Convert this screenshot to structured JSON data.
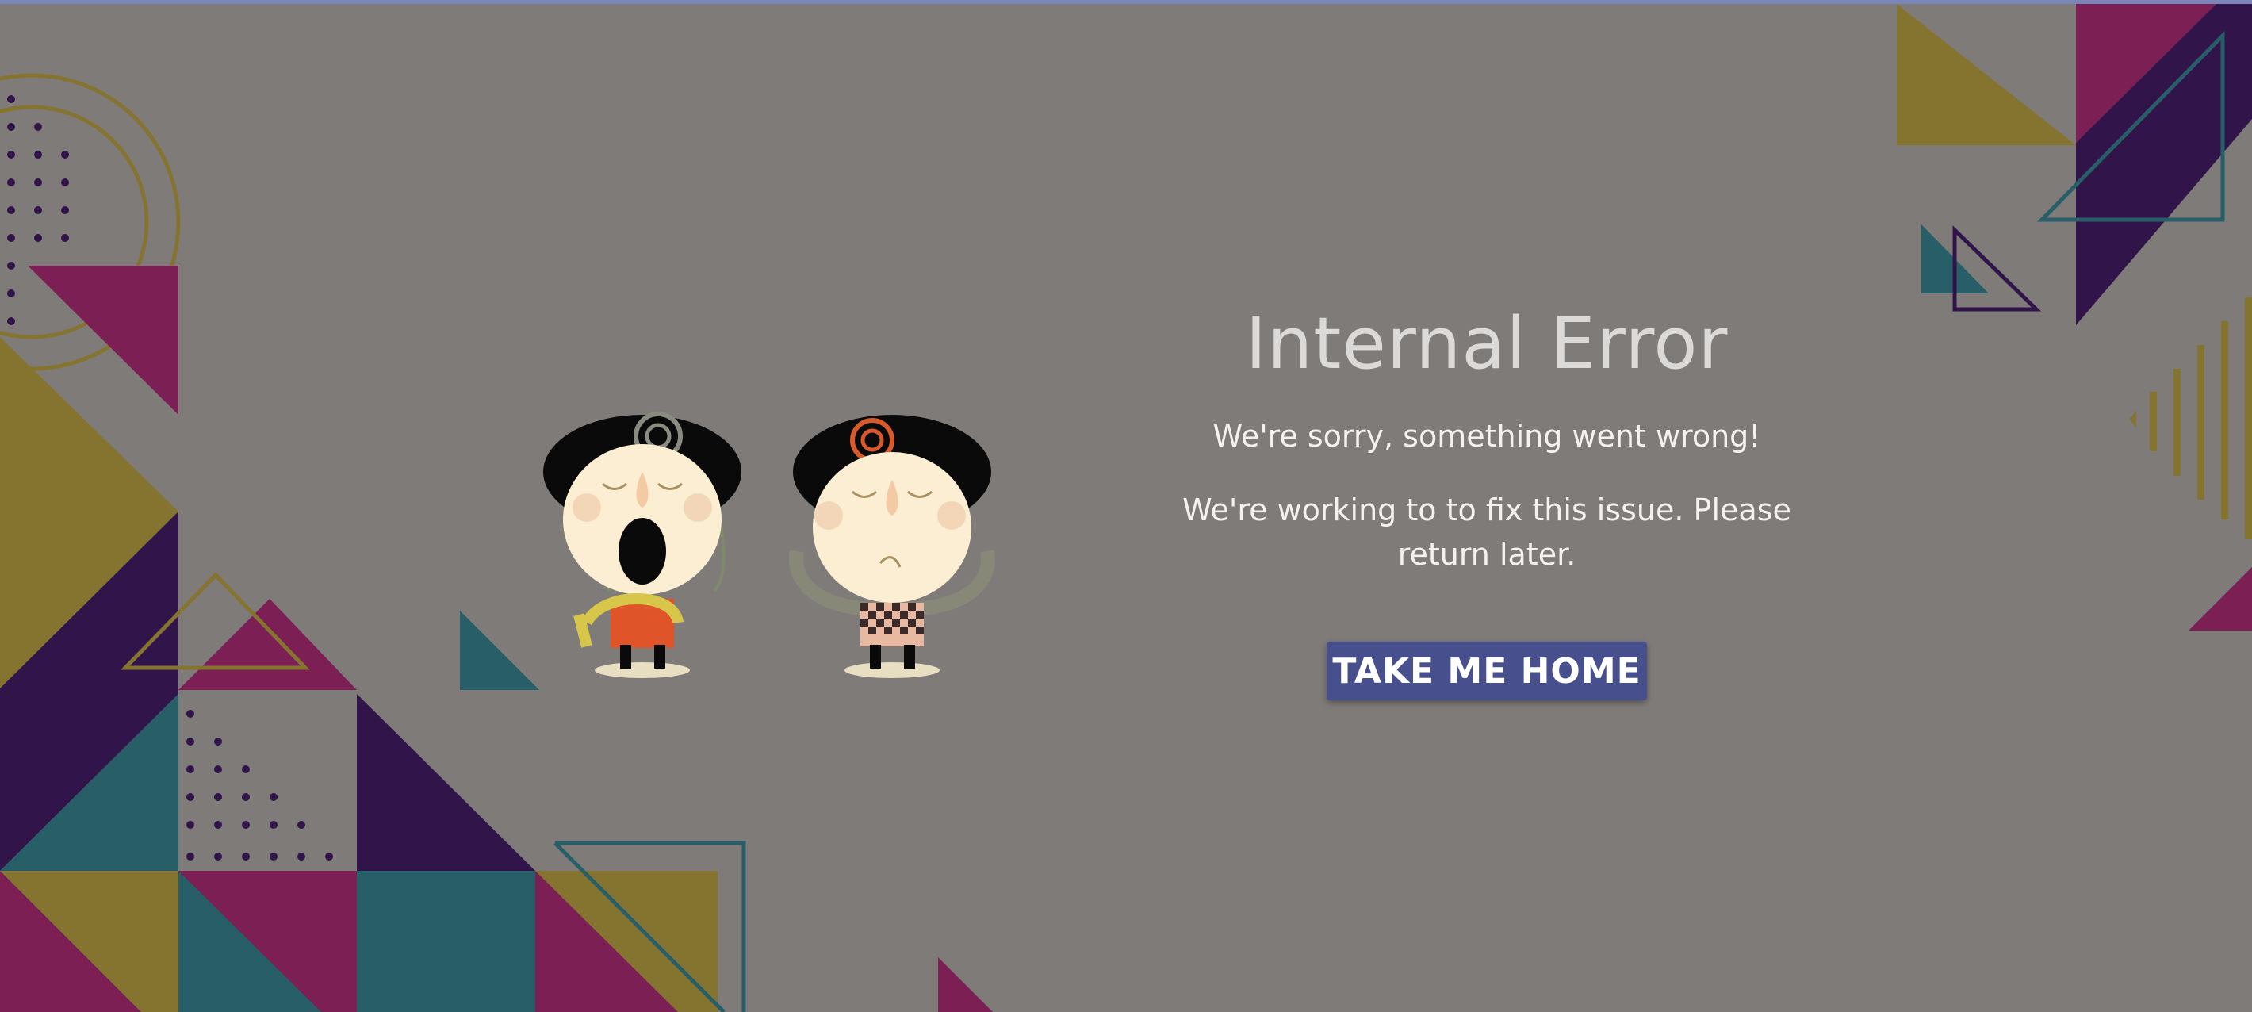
{
  "error": {
    "title": "Internal Error",
    "subtitle": "We're sorry, something went wrong!",
    "message": "We're working to to fix this issue. Please return later.",
    "button_label": "TAKE ME HOME"
  },
  "colors": {
    "background": "#7f7b78",
    "button": "#47508d",
    "olive": "#857430",
    "magenta": "#7b1f55",
    "teal": "#275e68",
    "indigo": "#30144a",
    "text": "#f4f1ee",
    "title": "#dcdad8"
  },
  "illustration": {
    "characters": [
      "yawning-girl-icon",
      "worried-girl-icon"
    ]
  }
}
